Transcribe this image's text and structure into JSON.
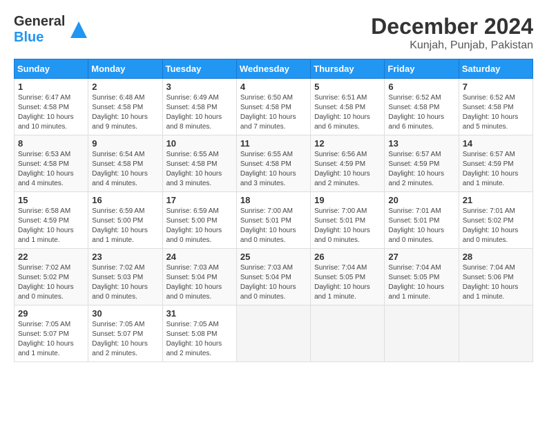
{
  "header": {
    "logo_general": "General",
    "logo_blue": "Blue",
    "month": "December 2024",
    "location": "Kunjah, Punjab, Pakistan"
  },
  "weekdays": [
    "Sunday",
    "Monday",
    "Tuesday",
    "Wednesday",
    "Thursday",
    "Friday",
    "Saturday"
  ],
  "weeks": [
    [
      {
        "day": 1,
        "info": "Sunrise: 6:47 AM\nSunset: 4:58 PM\nDaylight: 10 hours\nand 10 minutes."
      },
      {
        "day": 2,
        "info": "Sunrise: 6:48 AM\nSunset: 4:58 PM\nDaylight: 10 hours\nand 9 minutes."
      },
      {
        "day": 3,
        "info": "Sunrise: 6:49 AM\nSunset: 4:58 PM\nDaylight: 10 hours\nand 8 minutes."
      },
      {
        "day": 4,
        "info": "Sunrise: 6:50 AM\nSunset: 4:58 PM\nDaylight: 10 hours\nand 7 minutes."
      },
      {
        "day": 5,
        "info": "Sunrise: 6:51 AM\nSunset: 4:58 PM\nDaylight: 10 hours\nand 6 minutes."
      },
      {
        "day": 6,
        "info": "Sunrise: 6:52 AM\nSunset: 4:58 PM\nDaylight: 10 hours\nand 6 minutes."
      },
      {
        "day": 7,
        "info": "Sunrise: 6:52 AM\nSunset: 4:58 PM\nDaylight: 10 hours\nand 5 minutes."
      }
    ],
    [
      {
        "day": 8,
        "info": "Sunrise: 6:53 AM\nSunset: 4:58 PM\nDaylight: 10 hours\nand 4 minutes."
      },
      {
        "day": 9,
        "info": "Sunrise: 6:54 AM\nSunset: 4:58 PM\nDaylight: 10 hours\nand 4 minutes."
      },
      {
        "day": 10,
        "info": "Sunrise: 6:55 AM\nSunset: 4:58 PM\nDaylight: 10 hours\nand 3 minutes."
      },
      {
        "day": 11,
        "info": "Sunrise: 6:55 AM\nSunset: 4:58 PM\nDaylight: 10 hours\nand 3 minutes."
      },
      {
        "day": 12,
        "info": "Sunrise: 6:56 AM\nSunset: 4:59 PM\nDaylight: 10 hours\nand 2 minutes."
      },
      {
        "day": 13,
        "info": "Sunrise: 6:57 AM\nSunset: 4:59 PM\nDaylight: 10 hours\nand 2 minutes."
      },
      {
        "day": 14,
        "info": "Sunrise: 6:57 AM\nSunset: 4:59 PM\nDaylight: 10 hours\nand 1 minute."
      }
    ],
    [
      {
        "day": 15,
        "info": "Sunrise: 6:58 AM\nSunset: 4:59 PM\nDaylight: 10 hours\nand 1 minute."
      },
      {
        "day": 16,
        "info": "Sunrise: 6:59 AM\nSunset: 5:00 PM\nDaylight: 10 hours\nand 1 minute."
      },
      {
        "day": 17,
        "info": "Sunrise: 6:59 AM\nSunset: 5:00 PM\nDaylight: 10 hours\nand 0 minutes."
      },
      {
        "day": 18,
        "info": "Sunrise: 7:00 AM\nSunset: 5:01 PM\nDaylight: 10 hours\nand 0 minutes."
      },
      {
        "day": 19,
        "info": "Sunrise: 7:00 AM\nSunset: 5:01 PM\nDaylight: 10 hours\nand 0 minutes."
      },
      {
        "day": 20,
        "info": "Sunrise: 7:01 AM\nSunset: 5:01 PM\nDaylight: 10 hours\nand 0 minutes."
      },
      {
        "day": 21,
        "info": "Sunrise: 7:01 AM\nSunset: 5:02 PM\nDaylight: 10 hours\nand 0 minutes."
      }
    ],
    [
      {
        "day": 22,
        "info": "Sunrise: 7:02 AM\nSunset: 5:02 PM\nDaylight: 10 hours\nand 0 minutes."
      },
      {
        "day": 23,
        "info": "Sunrise: 7:02 AM\nSunset: 5:03 PM\nDaylight: 10 hours\nand 0 minutes."
      },
      {
        "day": 24,
        "info": "Sunrise: 7:03 AM\nSunset: 5:04 PM\nDaylight: 10 hours\nand 0 minutes."
      },
      {
        "day": 25,
        "info": "Sunrise: 7:03 AM\nSunset: 5:04 PM\nDaylight: 10 hours\nand 0 minutes."
      },
      {
        "day": 26,
        "info": "Sunrise: 7:04 AM\nSunset: 5:05 PM\nDaylight: 10 hours\nand 1 minute."
      },
      {
        "day": 27,
        "info": "Sunrise: 7:04 AM\nSunset: 5:05 PM\nDaylight: 10 hours\nand 1 minute."
      },
      {
        "day": 28,
        "info": "Sunrise: 7:04 AM\nSunset: 5:06 PM\nDaylight: 10 hours\nand 1 minute."
      }
    ],
    [
      {
        "day": 29,
        "info": "Sunrise: 7:05 AM\nSunset: 5:07 PM\nDaylight: 10 hours\nand 1 minute."
      },
      {
        "day": 30,
        "info": "Sunrise: 7:05 AM\nSunset: 5:07 PM\nDaylight: 10 hours\nand 2 minutes."
      },
      {
        "day": 31,
        "info": "Sunrise: 7:05 AM\nSunset: 5:08 PM\nDaylight: 10 hours\nand 2 minutes."
      },
      null,
      null,
      null,
      null
    ]
  ]
}
